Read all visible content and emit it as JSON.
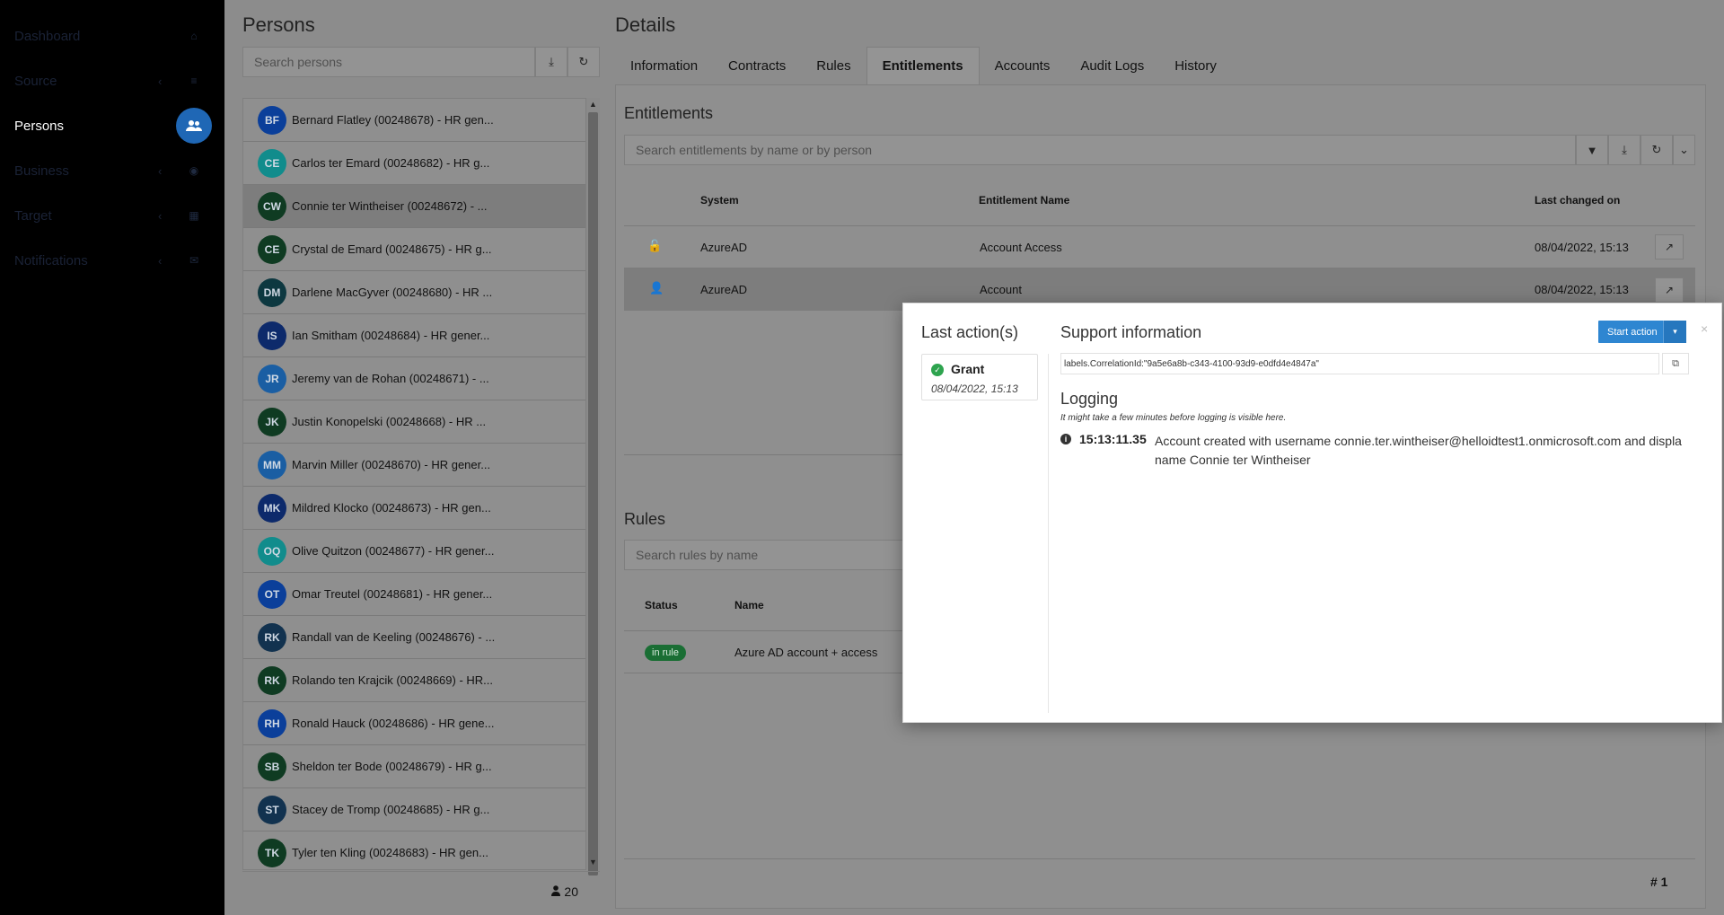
{
  "sidebar": {
    "items": [
      {
        "label": "Dashboard",
        "icon": "home-icon",
        "glyph": "⌂",
        "chevron": ""
      },
      {
        "label": "Source",
        "icon": "database-icon",
        "glyph": "≡",
        "chevron": "‹"
      },
      {
        "label": "Persons",
        "icon": "users-icon",
        "glyph": "👥",
        "chevron": ""
      },
      {
        "label": "Business",
        "icon": "business-icon",
        "glyph": "◉",
        "chevron": "‹"
      },
      {
        "label": "Target",
        "icon": "grid-icon",
        "glyph": "▦",
        "chevron": "‹"
      },
      {
        "label": "Notifications",
        "icon": "envelope-icon",
        "glyph": "✉",
        "chevron": "‹"
      }
    ]
  },
  "persons": {
    "title": "Persons",
    "search_placeholder": "Search persons",
    "download_glyph": "⤓",
    "refresh_glyph": "↻",
    "count": "20",
    "count_icon_glyph": "👤",
    "list": [
      {
        "initials": "BF",
        "name": "Bernard Flatley (00248678) - HR gen...",
        "color": "#0b3f9a"
      },
      {
        "initials": "CE",
        "name": "Carlos ter Emard (00248682) - HR g...",
        "color": "#118c8c"
      },
      {
        "initials": "CW",
        "name": "Connie ter Wintheiser (00248672) - ...",
        "color": "#0f3b22"
      },
      {
        "initials": "CE",
        "name": "Crystal de Emard (00248675) - HR g...",
        "color": "#0f3b22"
      },
      {
        "initials": "DM",
        "name": "Darlene MacGyver (00248680) - HR ...",
        "color": "#0d3840"
      },
      {
        "initials": "IS",
        "name": "Ian Smitham (00248684) - HR gener...",
        "color": "#0d2a6b"
      },
      {
        "initials": "JR",
        "name": "Jeremy van de Rohan (00248671) - ...",
        "color": "#1a5ea3"
      },
      {
        "initials": "JK",
        "name": "Justin Konopelski (00248668) - HR ...",
        "color": "#0f3b22"
      },
      {
        "initials": "MM",
        "name": "Marvin Miller (00248670) - HR gener...",
        "color": "#1a5ea3"
      },
      {
        "initials": "MK",
        "name": "Mildred Klocko (00248673) - HR gen...",
        "color": "#0d2a6b"
      },
      {
        "initials": "OQ",
        "name": "Olive Quitzon (00248677) - HR gener...",
        "color": "#118c8c"
      },
      {
        "initials": "OT",
        "name": "Omar Treutel (00248681) - HR gener...",
        "color": "#0b3f9a"
      },
      {
        "initials": "RK",
        "name": "Randall van de Keeling (00248676) - ...",
        "color": "#12324f"
      },
      {
        "initials": "RK",
        "name": "Rolando ten Krajcik (00248669) - HR...",
        "color": "#0f3b22"
      },
      {
        "initials": "RH",
        "name": "Ronald Hauck (00248686) - HR gene...",
        "color": "#0b3f9a"
      },
      {
        "initials": "SB",
        "name": "Sheldon ter Bode (00248679) - HR g...",
        "color": "#0f3b22"
      },
      {
        "initials": "ST",
        "name": "Stacey de Tromp (00248685) - HR g...",
        "color": "#12324f"
      },
      {
        "initials": "TK",
        "name": "Tyler ten Kling (00248683) - HR gen...",
        "color": "#0f3b22"
      }
    ]
  },
  "details": {
    "title": "Details",
    "tabs": [
      {
        "label": "Information",
        "active": false
      },
      {
        "label": "Contracts",
        "active": false
      },
      {
        "label": "Rules",
        "active": false
      },
      {
        "label": "Entitlements",
        "active": true
      },
      {
        "label": "Accounts",
        "active": false
      },
      {
        "label": "Audit Logs",
        "active": false
      },
      {
        "label": "History",
        "active": false
      }
    ],
    "entitlements": {
      "title": "Entitlements",
      "search_placeholder": "Search entitlements by name or by person",
      "filter_glyph": "▼",
      "download_glyph": "⤓",
      "refresh_glyph": "↻",
      "expand_glyph": "⌄",
      "columns": {
        "system": "System",
        "name": "Entitlement Name",
        "changed": "Last changed on"
      },
      "rows": [
        {
          "type_glyph": "🔓",
          "type_icon": "unlock-icon",
          "system": "AzureAD",
          "name": "Account Access",
          "changed": "08/04/2022, 15:13"
        },
        {
          "type_glyph": "👤",
          "type_icon": "user-icon",
          "system": "AzureAD",
          "name": "Account",
          "changed": "08/04/2022, 15:13"
        }
      ],
      "external_glyph": "↗"
    },
    "rules": {
      "title": "Rules",
      "search_placeholder": "Search rules by name",
      "columns": {
        "status": "Status",
        "name": "Name"
      },
      "rows": [
        {
          "status": "in rule",
          "name": "Azure AD account + access"
        }
      ]
    },
    "footer_count": "# 1"
  },
  "modal": {
    "last_actions_title": "Last action(s)",
    "action_name": "Grant",
    "action_date": "08/04/2022, 15:13",
    "support_title": "Support information",
    "start_action_label": "Start action",
    "caret_glyph": "▾",
    "close_glyph": "×",
    "correlation": "labels.CorrelationId:\"9a5e6a8b-c343-4100-93d9-e0dfd4e4847a\"",
    "copy_glyph": "⧉",
    "logging_title": "Logging",
    "logging_hint": "It might take a few minutes before logging is visible here.",
    "log_time": "15:13:11.35",
    "log_msg_line1": "Account created with username connie.ter.wintheiser@helloidtest1.onmicrosoft.com and displa",
    "log_msg_line2": "name Connie ter Wintheiser"
  }
}
